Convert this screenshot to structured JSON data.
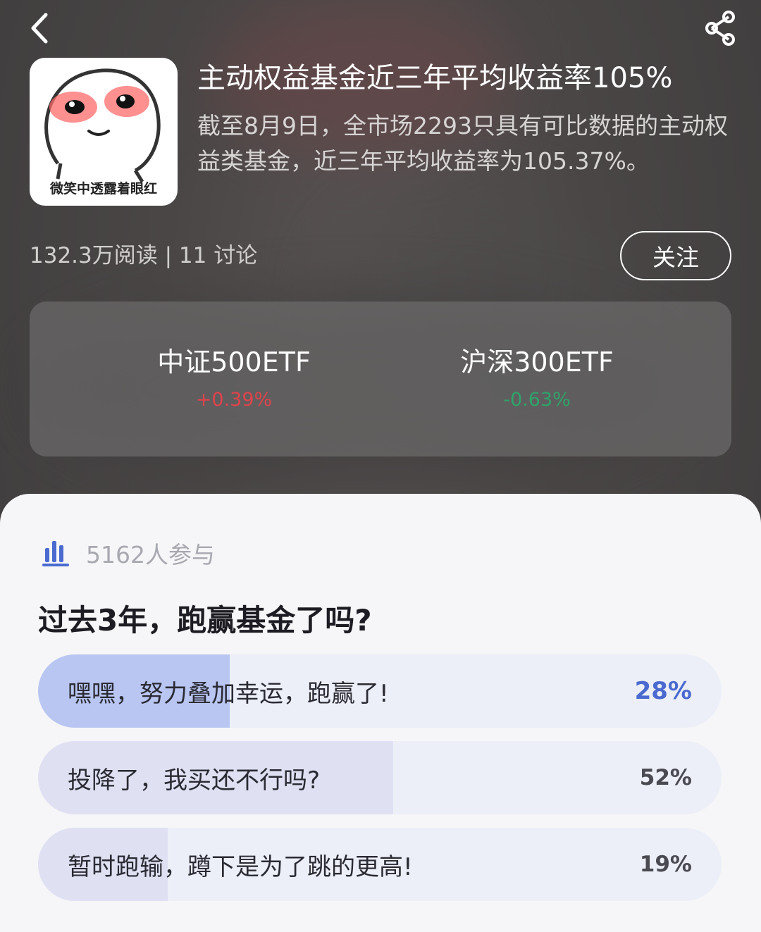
{
  "header": {
    "back_icon": "chevron-left-icon",
    "share_icon": "share-icon"
  },
  "topic": {
    "thumb_caption": "微笑中透露着眼红",
    "title": "主动权益基金近三年平均收益率105%",
    "description": "截至8月9日，全市场2293只具有可比数据的主动权益类基金，近三年平均收益率为105.37%。",
    "stats": "132.3万阅读 | 11 讨论",
    "follow_label": "关注"
  },
  "etfs": [
    {
      "name": "中证500ETF",
      "change": "+0.39%",
      "color": "#e0434c"
    },
    {
      "name": "沪深300ETF",
      "change": "-0.63%",
      "color": "#2fa36b"
    }
  ],
  "poll": {
    "icon": "bar-chart-icon",
    "participants": "5162人参与",
    "question": "过去3年，跑赢基金了吗?",
    "options": [
      {
        "label": "嘿嘿，努力叠加幸运，跑赢了!",
        "percent_text": "28%",
        "fraction": 0.28,
        "selected": true
      },
      {
        "label": "投降了，我买还不行吗?",
        "percent_text": "52%",
        "fraction": 0.52,
        "selected": false
      },
      {
        "label": "暂时跑输，蹲下是为了跳的更高!",
        "percent_text": "19%",
        "fraction": 0.19,
        "selected": false
      }
    ],
    "colors": {
      "selected_fill": "#b9c6f2",
      "fill": "#dfe1f3",
      "accent": "#4a6ad0"
    }
  }
}
